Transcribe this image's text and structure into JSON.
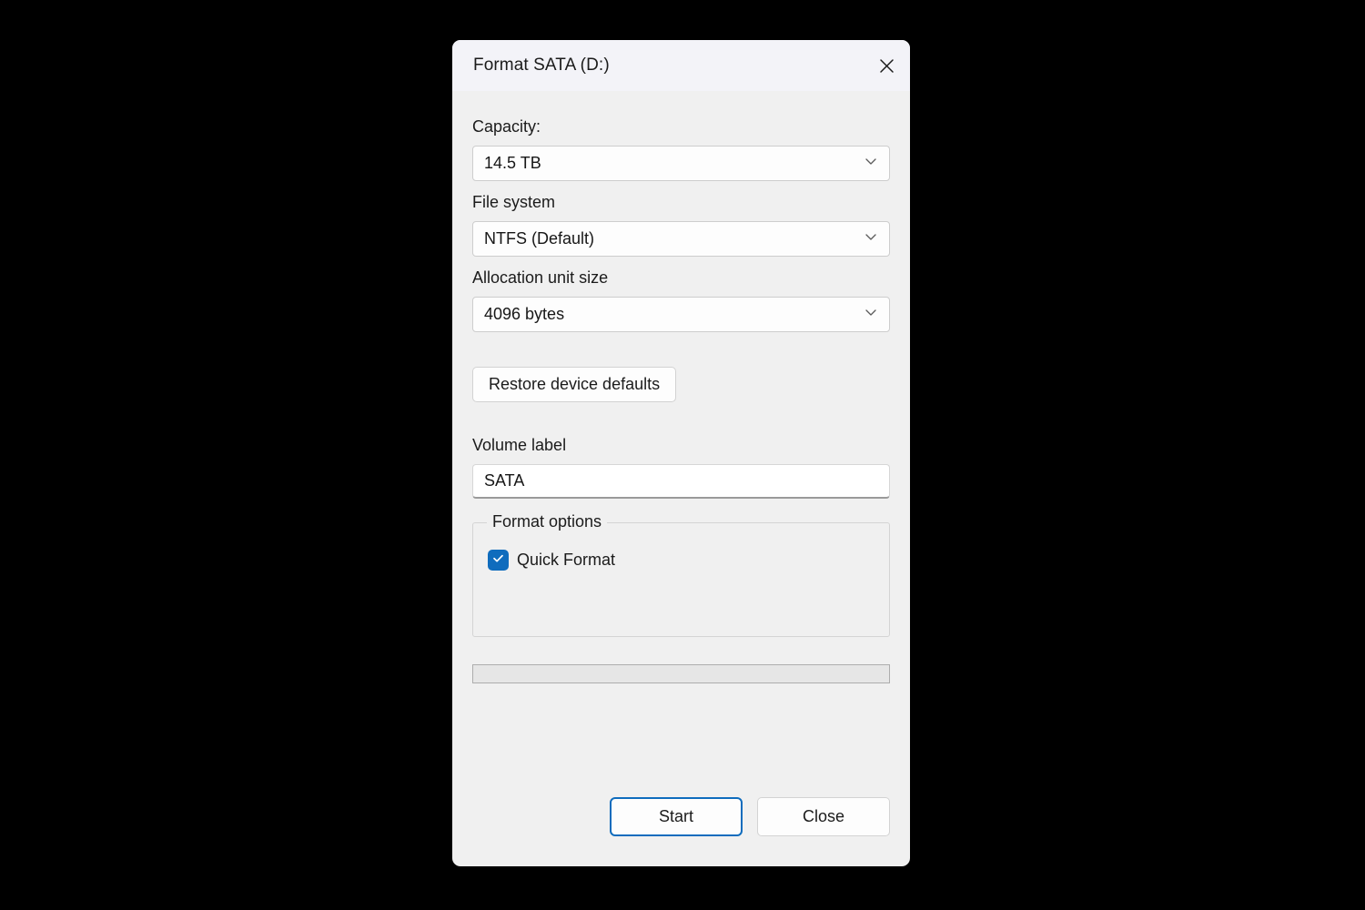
{
  "dialog": {
    "title": "Format SATA (D:)",
    "close_icon": "close-icon"
  },
  "capacity": {
    "label": "Capacity:",
    "value": "14.5 TB",
    "chevron_icon": "chevron-down-icon"
  },
  "file_system": {
    "label": "File system",
    "value": "NTFS (Default)",
    "chevron_icon": "chevron-down-icon"
  },
  "allocation_unit_size": {
    "label": "Allocation unit size",
    "value": "4096 bytes",
    "chevron_icon": "chevron-down-icon"
  },
  "restore_defaults": {
    "label": "Restore device defaults"
  },
  "volume_label": {
    "label": "Volume label",
    "value": "SATA",
    "placeholder": ""
  },
  "format_options": {
    "legend": "Format options",
    "quick_format": {
      "label": "Quick Format",
      "checked": true,
      "check_icon": "checkmark-icon"
    }
  },
  "progress": {
    "percent": 0,
    "value_text": ""
  },
  "footer": {
    "start_label": "Start",
    "close_label": "Close"
  },
  "colors": {
    "accent": "#0f6cbd",
    "checkbox_fill": "#0f6cbd",
    "dialog_bg": "#f0f0f0",
    "titlebar_bg": "#f3f3f8",
    "text": "#1b1b1b",
    "field_bg": "#fdfdfd"
  }
}
